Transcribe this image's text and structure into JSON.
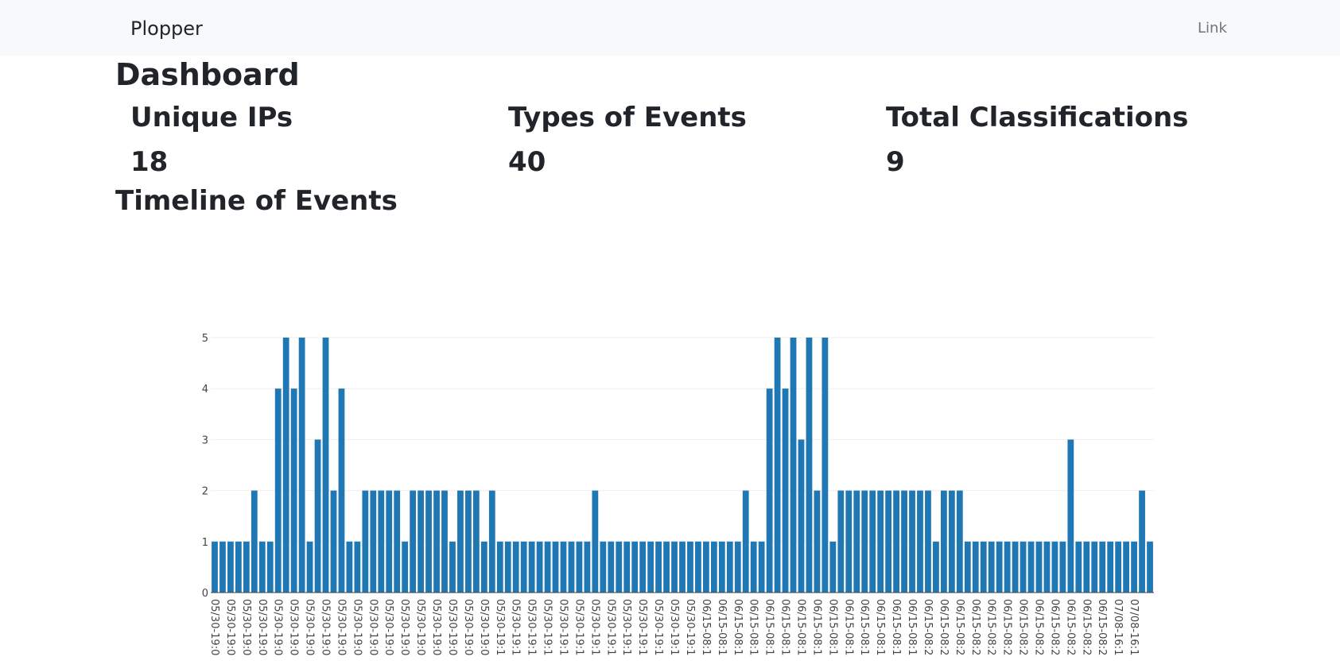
{
  "navbar": {
    "brand": "Plopper",
    "link": "Link"
  },
  "page_title": "Dashboard",
  "stats": [
    {
      "label": "Unique IPs",
      "value": "18"
    },
    {
      "label": "Types of Events",
      "value": "40"
    },
    {
      "label": "Total Classifications",
      "value": "9"
    }
  ],
  "section_title": "Timeline of Events",
  "colors": {
    "bar": "#1f77b4",
    "grid": "#eeeeee",
    "navbar": "#f8f9fa"
  },
  "chart_data": {
    "type": "bar",
    "title": "",
    "xlabel": "",
    "ylabel": "",
    "ylim": [
      0,
      5
    ],
    "yticks": [
      0,
      1,
      2,
      3,
      4,
      5
    ],
    "grid": true,
    "categories": [
      "05/30-19:0",
      "05/30-19:0",
      "05/30-19:0",
      "05/30-19:0",
      "05/30-19:0",
      "05/30-19:0",
      "05/30-19:0",
      "05/30-19:0",
      "05/30-19:0",
      "05/30-19:0",
      "05/30-19:0",
      "05/30-19:0",
      "05/30-19:0",
      "05/30-19:0",
      "05/30-19:0",
      "05/30-19:0",
      "05/30-19:0",
      "05/30-19:0",
      "05/30-19:0",
      "05/30-19:0",
      "05/30-19:0",
      "05/30-19:0",
      "05/30-19:0",
      "05/30-19:0",
      "05/30-19:0",
      "05/30-19:0",
      "05/30-19:0",
      "05/30-19:0",
      "05/30-19:0",
      "05/30-19:0",
      "05/30-19:0",
      "05/30-19:0",
      "05/30-19:0",
      "05/30-19:0",
      "05/30-19:0",
      "05/30-19:1",
      "05/30-19:1",
      "05/30-19:1",
      "05/30-19:1",
      "05/30-19:1",
      "05/30-19:1",
      "05/30-19:1",
      "05/30-19:1",
      "05/30-19:1",
      "05/30-19:1",
      "05/30-19:1",
      "05/30-19:1",
      "05/30-19:1",
      "05/30-19:1",
      "05/30-19:1",
      "05/30-19:1",
      "05/30-19:1",
      "05/30-19:1",
      "05/30-19:1",
      "05/30-19:1",
      "05/30-19:1",
      "05/30-19:1",
      "05/30-19:1",
      "05/30-19:1",
      "05/30-19:1",
      "05/30-19:1",
      "05/30-19:1",
      "06/15-08:1",
      "06/15-08:1",
      "06/15-08:1",
      "06/15-08:1",
      "06/15-08:1",
      "06/15-08:1",
      "06/15-08:1",
      "06/15-08:1",
      "06/15-08:1",
      "06/15-08:1",
      "06/15-08:1",
      "06/15-08:1",
      "06/15-08:1",
      "06/15-08:1",
      "06/15-08:1",
      "06/15-08:1",
      "06/15-08:1",
      "06/15-08:1",
      "06/15-08:1",
      "06/15-08:1",
      "06/15-08:1",
      "06/15-08:1",
      "06/15-08:1",
      "06/15-08:1",
      "06/15-08:1",
      "06/15-08:1",
      "06/15-08:1",
      "06/15-08:1",
      "06/15-08:2",
      "06/15-08:2",
      "06/15-08:2",
      "06/15-08:2",
      "06/15-08:2",
      "06/15-08:2",
      "06/15-08:2",
      "06/15-08:2",
      "06/15-08:2",
      "06/15-08:2",
      "06/15-08:2",
      "06/15-08:2",
      "06/15-08:2",
      "06/15-08:2",
      "06/15-08:2",
      "06/15-08:2",
      "06/15-08:2",
      "06/15-08:2",
      "06/15-08:2",
      "06/15-08:2",
      "06/15-08:2",
      "06/15-08:2",
      "06/15-08:2",
      "07/08-16:1",
      "07/08-16:1",
      "07/08-16:1",
      "07/08-16:1",
      "07/08-16:1"
    ],
    "values": [
      1,
      1,
      1,
      1,
      1,
      2,
      1,
      1,
      4,
      5,
      4,
      5,
      1,
      3,
      5,
      2,
      4,
      1,
      1,
      2,
      2,
      2,
      2,
      2,
      1,
      2,
      2,
      2,
      2,
      2,
      1,
      2,
      2,
      2,
      1,
      2,
      1,
      1,
      1,
      1,
      1,
      1,
      1,
      1,
      1,
      1,
      1,
      1,
      2,
      1,
      1,
      1,
      1,
      1,
      1,
      1,
      1,
      1,
      1,
      1,
      1,
      1,
      1,
      1,
      1,
      1,
      1,
      2,
      1,
      1,
      4,
      5,
      4,
      5,
      3,
      5,
      2,
      5,
      1,
      2,
      2,
      2,
      2,
      2,
      2,
      2,
      2,
      2,
      2,
      2,
      2,
      1,
      2,
      2,
      2,
      1,
      1,
      1,
      1,
      1,
      1,
      1,
      1,
      1,
      1,
      1,
      1,
      1,
      3,
      1,
      1,
      1,
      1,
      1,
      1,
      1,
      1,
      2,
      1
    ]
  }
}
